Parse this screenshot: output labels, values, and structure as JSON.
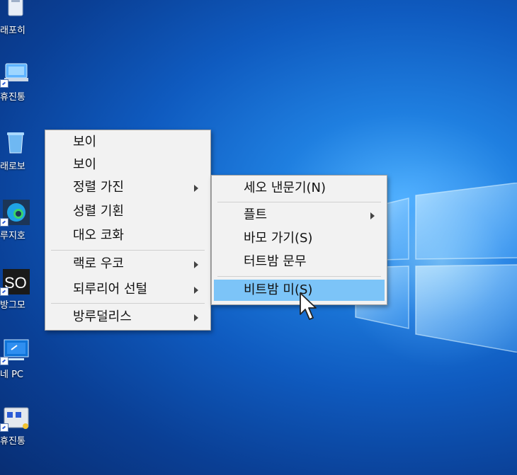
{
  "desktop": {
    "icons": [
      {
        "label": "래포히"
      },
      {
        "label": "휴진통"
      },
      {
        "label": "래로보"
      },
      {
        "label": "루지호"
      },
      {
        "label": "방그모"
      },
      {
        "label": "네 PC"
      },
      {
        "label": "휴진통"
      }
    ]
  },
  "context_menu": {
    "items": [
      {
        "label": "보이"
      },
      {
        "label": "보이"
      },
      {
        "label": "정렬 가진"
      },
      {
        "label": "성렬 기횐"
      },
      {
        "label": "대오 코화"
      },
      {
        "label": "랙로 우코"
      },
      {
        "label": "되루리어 선털"
      },
      {
        "label": "방루덜리스"
      }
    ]
  },
  "submenu": {
    "items": [
      {
        "label": "세오 낸문기(N)"
      },
      {
        "label": "플트"
      },
      {
        "label": "바모 가기(S)"
      },
      {
        "label": "터트밤 문무"
      },
      {
        "label": "비트밤 미(S)"
      }
    ]
  },
  "colors": {
    "menu_background": "#f2f2f2",
    "highlight": "#7cc4f8",
    "desktop_blue": "#0f5bc0"
  }
}
